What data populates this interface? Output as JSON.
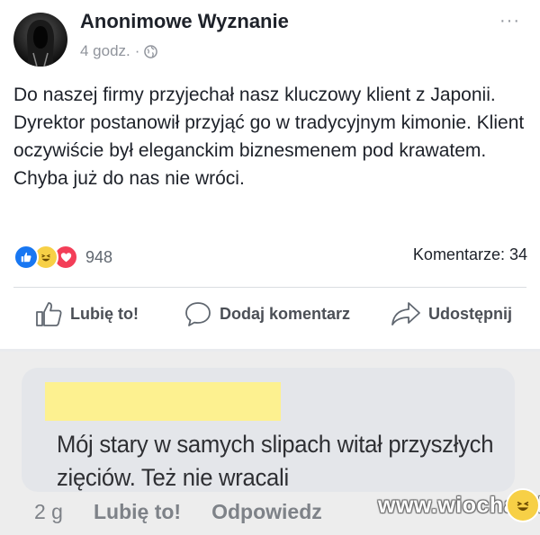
{
  "post": {
    "author": "Anonimowe Wyznanie",
    "time": "4 godz.",
    "meta_sep": "·",
    "more": "···",
    "text": "Do naszej firmy przyjechał nasz kluczowy klient z Japonii. Dyrektor postanowił przyjąć go w tradycyjnym kimonie. Klient oczywiście był eleganckim biznesmenem pod krawatem. Chyba już do nas nie wróci.",
    "reaction_icons": [
      "like-icon",
      "haha-icon",
      "love-icon"
    ],
    "reaction_count": "948",
    "comments_count": "Komentarze: 34",
    "actions": {
      "like": "Lubię to!",
      "comment": "Dodaj komentarz",
      "share": "Udostępnij"
    }
  },
  "comment": {
    "text": "Mój stary w samych slipach witał przyszłych zięciów. Też nie wracali",
    "time": "2 g",
    "like": "Lubię to!",
    "reply": "Odpowiedz",
    "reaction_icon": "haha-icon"
  },
  "watermark": "www.wiocha.pl",
  "colors": {
    "like_blue": "#1877f2",
    "haha_yellow": "#f7d046",
    "love_red": "#f33e58",
    "redaction_yellow": "#fdf190",
    "secondary_text": "#90949c"
  }
}
